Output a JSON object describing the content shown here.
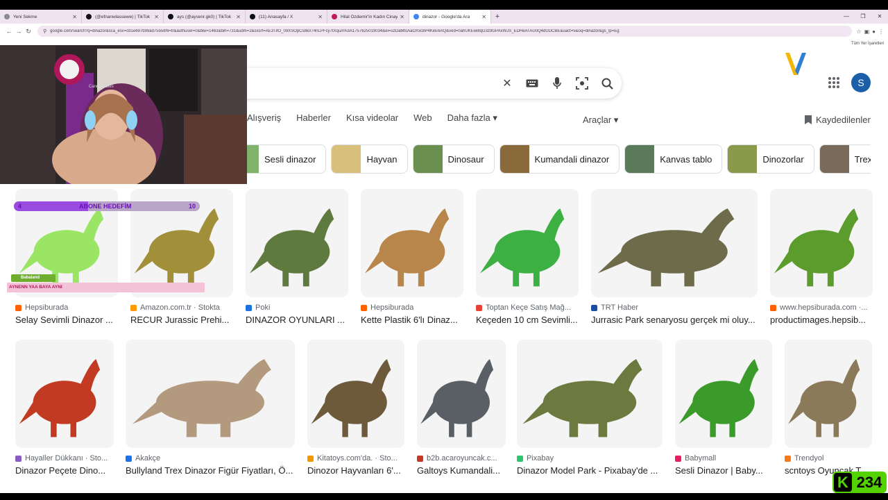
{
  "browser": {
    "tabs": [
      {
        "label": "Yeni Sekme",
        "color": "#8a8a8a"
      },
      {
        "label": "(@efnanwlassewe) | TikTok",
        "color": "#111111"
      },
      {
        "label": "ays (@aysenr.gk0) | TikTok",
        "color": "#111111"
      },
      {
        "label": "(11) Anasayfa / X",
        "color": "#111111"
      },
      {
        "label": "Hilal Özdemir'in Kadın Cinayeti",
        "color": "#c2185b"
      },
      {
        "label": "dinazor - Google'da Ara",
        "color": "#4285f4"
      }
    ],
    "new_tab": "+",
    "url": "google.com/search?q=dinazor&sca_esv=cb1e697b99ad75558hl=tr&authuser=0&biw=1463&bih=731&udm=2&sxsrf=AE3TifO_09XSOpCs8lor74nLPFcy7tXquA%3A1757625019034&ei=uzDaMtsAaOXxc8P4KeE6AQ&ved=0ahUKEwi8qG3z9GPAxWJS_EDHeATAU0Q4dUDCBE&uact=5&oq=dinazor&gs_lp=Eg",
    "bookmarks_label": "Tüm Yer İşaretleri"
  },
  "search": {
    "clear_icon": "✕",
    "nav_tabs": [
      "Alışveriş",
      "Haberler",
      "Kısa videolar",
      "Web",
      "Daha fazla ▾"
    ],
    "tools": "Araçlar ▾",
    "saved": "Kaydedilenler",
    "avatar_letter": "S"
  },
  "chips": [
    {
      "label": "Sesli dinazor",
      "color": "#7fb26a"
    },
    {
      "label": "Hayvan",
      "color": "#d8c07a"
    },
    {
      "label": "Dinosaur",
      "color": "#6b8f4e"
    },
    {
      "label": "Kumandali dinazor",
      "color": "#8a6a3b"
    },
    {
      "label": "Kanvas tablo",
      "color": "#5a7a5a"
    },
    {
      "label": "Dinozorlar",
      "color": "#8a9a4a"
    },
    {
      "label": "Trex",
      "color": "#7a6a5a"
    }
  ],
  "results_row1": [
    {
      "source": "Hepsiburada",
      "title": "Selay Sevimli Dinazor ...",
      "fav": "#ff6000",
      "color": "#9be564"
    },
    {
      "source": "Amazon.com.tr · Stokta",
      "title": "RECUR Jurassic Prehi...",
      "fav": "#ff9900",
      "color": "#a28f3a"
    },
    {
      "source": "Poki",
      "title": "DINAZOR OYUNLARI ...",
      "fav": "#1c70e0",
      "color": "#5f7a3e"
    },
    {
      "source": "Hepsiburada",
      "title": "Kette Plastik 6'lı Dinaz...",
      "fav": "#ff6000",
      "color": "#b8864a"
    },
    {
      "source": "Toptan Keçe Satış Mağ...",
      "title": "Keçeden 10 cm Sevimli...",
      "fav": "#e94235",
      "color": "#3cb043"
    },
    {
      "source": "TRT Haber",
      "title": "Jurrasic Park senaryosu gerçek mi oluy...",
      "fav": "#1a4d9c",
      "color": "#6d6b4a"
    },
    {
      "source": "www.hepsiburada.com ·...",
      "title": "productimages.hepsib...",
      "fav": "#ff6000",
      "color": "#5c9c2c"
    }
  ],
  "results_row2": [
    {
      "source": "Hayaller Dükkanı · Sto...",
      "title": "Dinazor Peçete Dino...",
      "fav": "#8a5cc2",
      "color": "#c23a22"
    },
    {
      "source": "Akakçe",
      "title": "Bullyland Trex Dinazor Figür Fiyatları, Ö...",
      "fav": "#1a73e8",
      "color": "#b39a7e"
    },
    {
      "source": "Kitatoys.com'da. · Sto...",
      "title": "Dinozor Hayvanları 6'...",
      "fav": "#f29900",
      "color": "#6d5a3a"
    },
    {
      "source": "b2b.acaroyuncak.c...",
      "title": "Galtoys Kumandali...",
      "fav": "#c23a22",
      "color": "#5a5f66"
    },
    {
      "source": "Pixabay",
      "title": "Dinazor Model Park - Pixabay'de ...",
      "fav": "#2ec66d",
      "color": "#6c7a40"
    },
    {
      "source": "Babymall",
      "title": "Sesli Dinazor | Baby...",
      "fav": "#e91e63",
      "color": "#3a9a2a"
    },
    {
      "source": "Trendyol",
      "title": "scntoys Oyuncak T...",
      "fav": "#f27a1a",
      "color": "#8a7a5a"
    }
  ],
  "overlays": {
    "webcam_channel": "CandyBabies",
    "sub_goal": {
      "label": "ABONE HEDEFİM",
      "current": "4",
      "target": "10",
      "progress": 0.4
    },
    "alert_name": "Babaland",
    "alert_message": "AYNENN YAA BAYA AYNI",
    "kick_letter": "K",
    "viewer_count": "234"
  }
}
